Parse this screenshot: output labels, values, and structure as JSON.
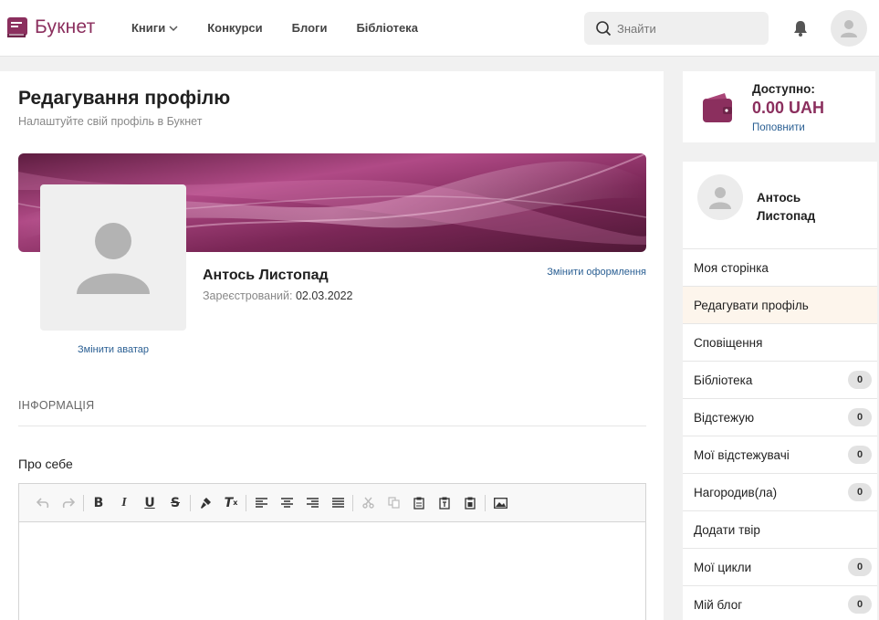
{
  "header": {
    "logo_text": "Букнет",
    "nav": [
      {
        "label": "Книги",
        "has_dropdown": true
      },
      {
        "label": "Конкурси"
      },
      {
        "label": "Блоги"
      },
      {
        "label": "Бібліотека"
      }
    ],
    "search_placeholder": "Знайти"
  },
  "main": {
    "title": "Редагування профілю",
    "subtitle": "Налаштуйте свій профіль в Букнет",
    "user_name": "Антось Листопад",
    "registered_label": "Зареєстрований:",
    "registered_date": "02.03.2022",
    "change_design": "Змінити оформлення",
    "change_avatar": "Змінити аватар",
    "section_info": "ІНФОРМАЦІЯ",
    "about_label": "Про себе"
  },
  "wallet": {
    "label": "Доступно:",
    "amount": "0.00 UAH",
    "topup": "Поповнити"
  },
  "sidebar": {
    "user_name": "Антось Листопад",
    "items": [
      {
        "label": "Моя сторінка",
        "count": null
      },
      {
        "label": "Редагувати профіль",
        "count": null,
        "active": true
      },
      {
        "label": "Сповіщення",
        "count": null
      },
      {
        "label": "Бібліотека",
        "count": "0"
      },
      {
        "label": "Відстежую",
        "count": "0"
      },
      {
        "label": "Мої відстежувачі",
        "count": "0"
      },
      {
        "label": "Нагородив(ла)",
        "count": "0"
      },
      {
        "label": "Додати твір",
        "count": null
      },
      {
        "label": "Мої цикли",
        "count": "0"
      },
      {
        "label": "Мій блог",
        "count": "0"
      }
    ]
  },
  "colors": {
    "brand": "#8b2f5e",
    "link": "#2a5f93",
    "active_item_bg": "#fdf5ec"
  },
  "editor_toolbar_icons": [
    "undo-icon",
    "redo-icon",
    "bold-icon",
    "italic-icon",
    "underline-icon",
    "strikethrough-icon",
    "format-paint-icon",
    "clear-format-icon",
    "align-left-icon",
    "align-center-icon",
    "align-right-icon",
    "justify-icon",
    "cut-icon",
    "copy-icon",
    "paste-icon",
    "paste-text-icon",
    "paste-word-icon",
    "image-icon"
  ]
}
